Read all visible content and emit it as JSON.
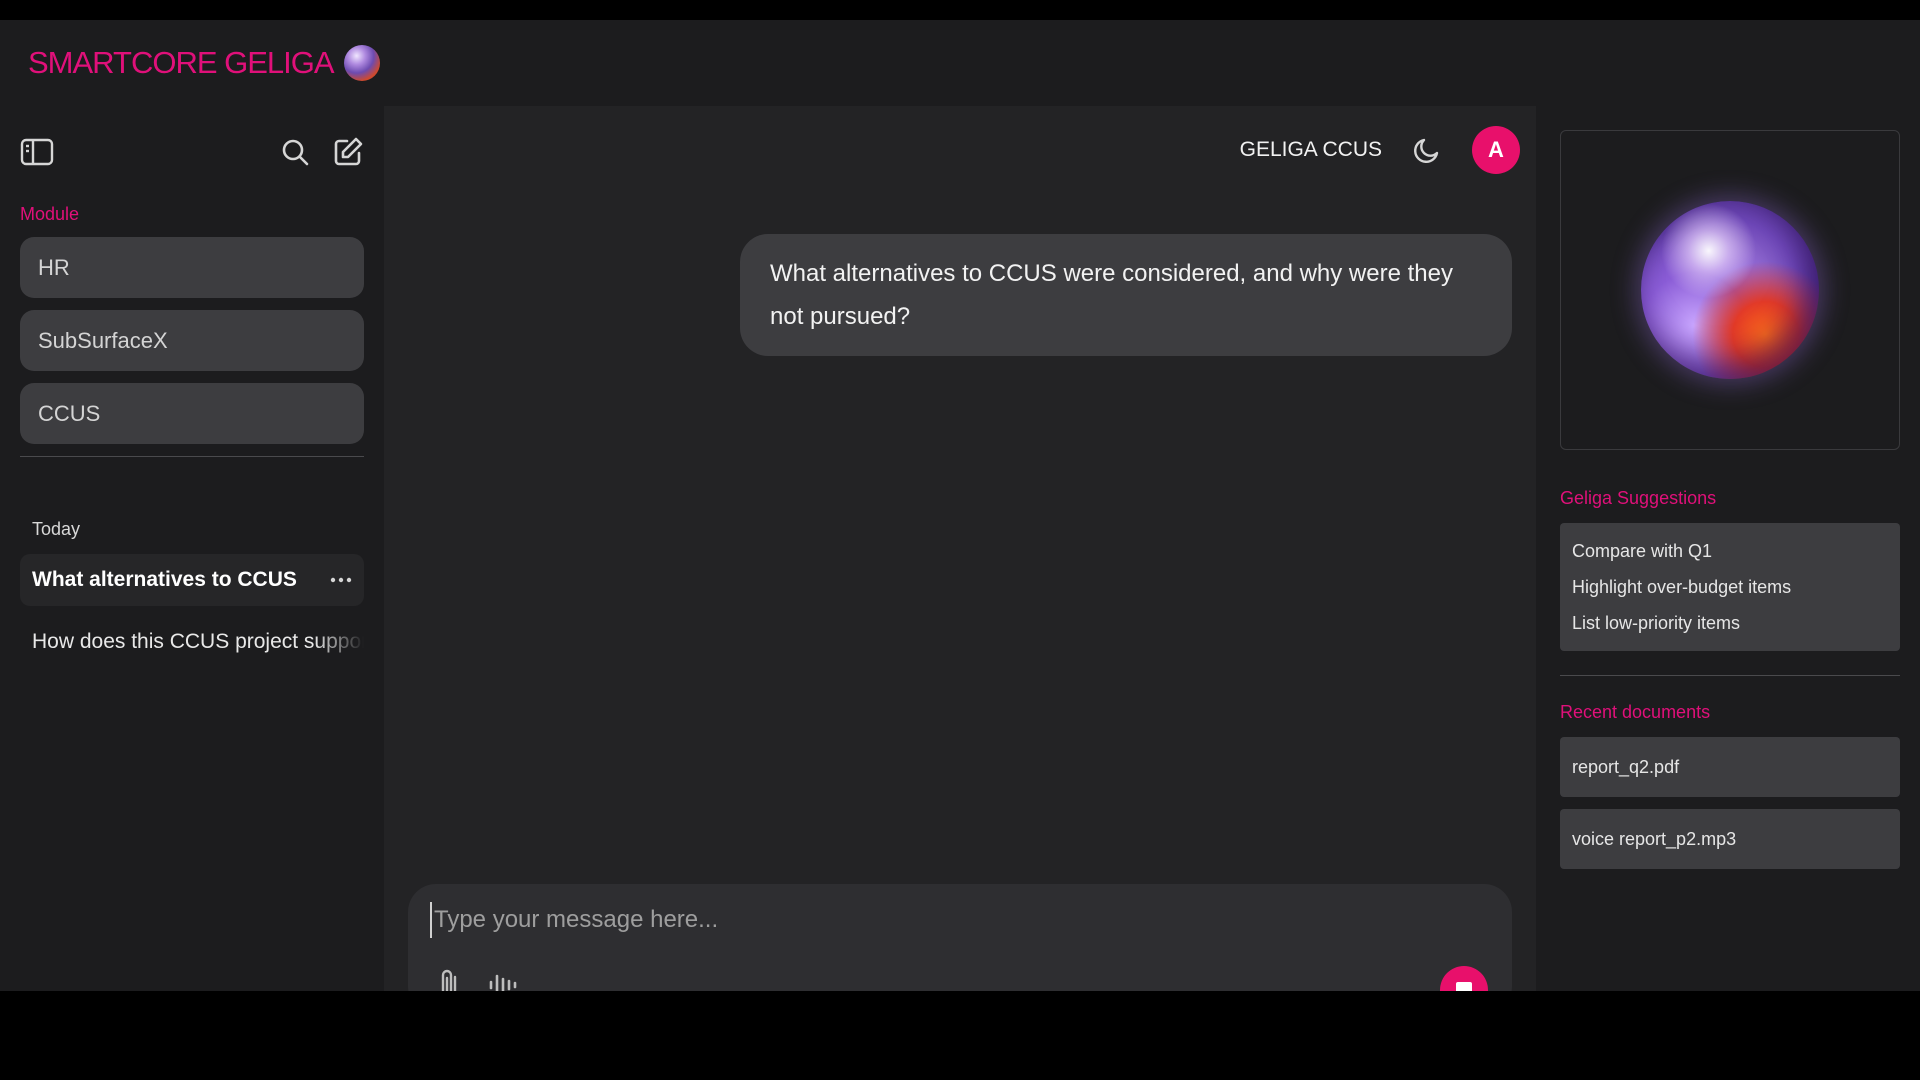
{
  "brand": {
    "name_part1": "SMARTCORE",
    "name_part2": "GELIGA"
  },
  "sidebar": {
    "module_label": "Module",
    "modules": [
      {
        "label": "HR"
      },
      {
        "label": "SubSurfaceX"
      },
      {
        "label": "CCUS"
      }
    ],
    "today_label": "Today",
    "history": [
      {
        "label": "What alternatives to CCUS"
      },
      {
        "label": "How does this CCUS project support"
      }
    ]
  },
  "main": {
    "module_title": "GELIGA CCUS",
    "avatar_initial": "A",
    "messages": [
      {
        "role": "user",
        "text": "What alternatives to CCUS were considered, and why were they not pursued?"
      }
    ],
    "composer": {
      "placeholder": "Type your message here..."
    }
  },
  "right_panel": {
    "suggestions_label": "Geliga Suggestions",
    "suggestions": [
      "Compare with Q1",
      "Highlight over-budget items",
      "List low-priority items"
    ],
    "recent_label": "Recent documents",
    "documents": [
      "report_q2.pdf",
      "voice report_p2.mp3"
    ]
  },
  "colors": {
    "accent": "#e8106b",
    "brand": "#e0107a",
    "background": "#1c1c1e",
    "main_bg": "#232325",
    "card": "#3d3d40"
  },
  "icons": {
    "sidebar_toggle": "sidebar-toggle-icon",
    "search": "search-icon",
    "new_chat": "edit-icon",
    "theme": "moon-icon",
    "attach": "paperclip-icon",
    "voice": "audio-wave-icon",
    "stop": "stop-icon",
    "more": "more-horizontal-icon"
  }
}
